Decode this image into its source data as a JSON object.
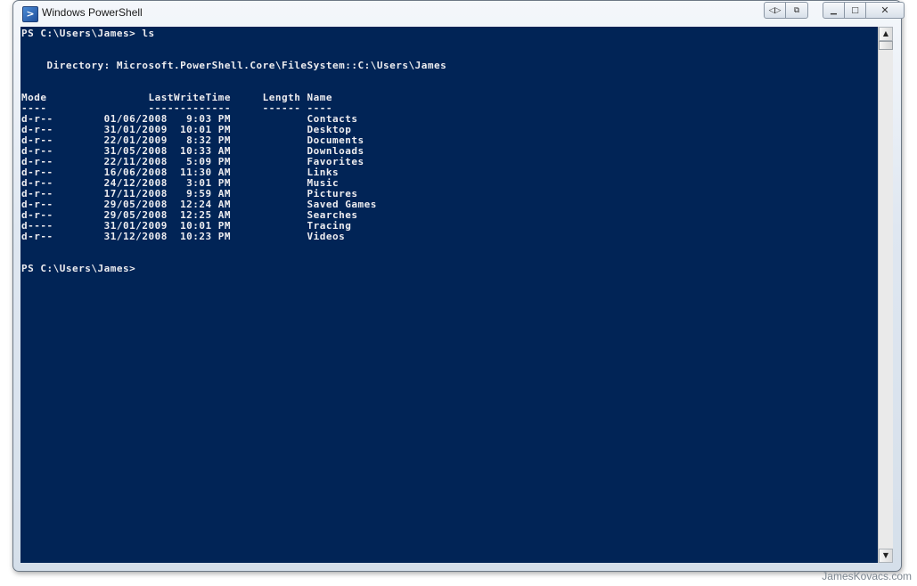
{
  "window": {
    "title": "Windows PowerShell",
    "icon": "powershell-icon"
  },
  "titlebar_controls": {
    "extra": [
      "resize-icon",
      "tile-icon"
    ],
    "minimize_icon": "minimize-icon",
    "maximize_icon": "maximize-icon",
    "close_icon": "close-icon"
  },
  "colors": {
    "console_background": "#012456",
    "console_text": "#eeedf0"
  },
  "console": {
    "command_line": "PS C:\\Users\\James> ls",
    "directory_line": "    Directory: Microsoft.PowerShell.Core\\FileSystem::C:\\Users\\James",
    "header_line": "Mode                LastWriteTime     Length Name",
    "separator_line": "----                -------------     ------ ----",
    "rows": [
      "d-r--        01/06/2008   9:03 PM            Contacts",
      "d-r--        31/01/2009  10:01 PM            Desktop",
      "d-r--        22/01/2009   8:32 PM            Documents",
      "d-r--        31/05/2008  10:33 AM            Downloads",
      "d-r--        22/11/2008   5:09 PM            Favorites",
      "d-r--        16/06/2008  11:30 AM            Links",
      "d-r--        24/12/2008   3:01 PM            Music",
      "d-r--        17/11/2008   9:59 AM            Pictures",
      "d-r--        29/05/2008  12:24 AM            Saved Games",
      "d-r--        29/05/2008  12:25 AM            Searches",
      "d----        31/01/2009  10:01 PM            Tracing",
      "d-r--        31/12/2008  10:23 PM            Videos"
    ],
    "prompt_line": "PS C:\\Users\\James>"
  },
  "scrollbar": {
    "up_icon": "scroll-up-arrow-icon",
    "down_icon": "scroll-down-arrow-icon"
  },
  "watermark": "JamesKovacs.com"
}
